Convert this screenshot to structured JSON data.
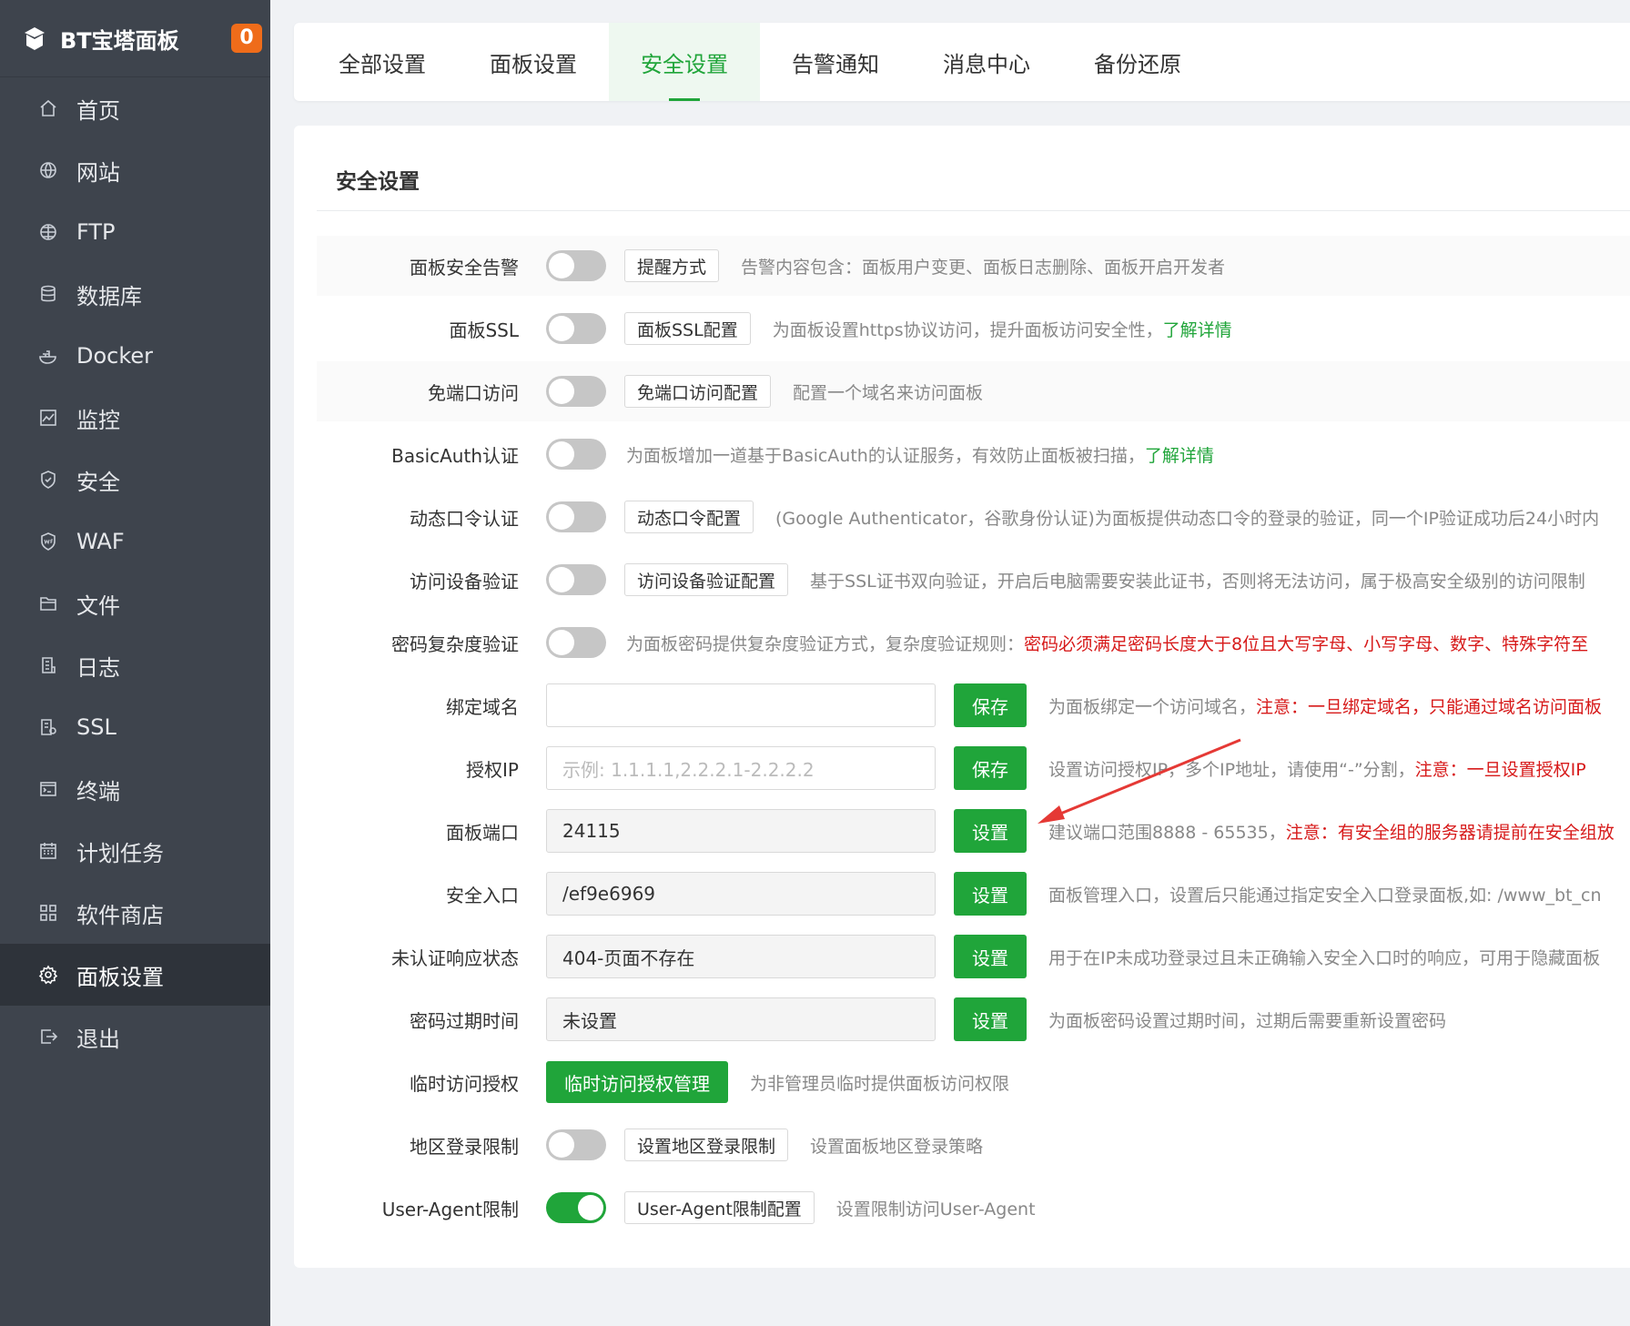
{
  "sidebar": {
    "title": "BT宝塔面板",
    "badge": "0",
    "items": [
      {
        "label": "首页",
        "icon": "home-icon"
      },
      {
        "label": "网站",
        "icon": "globe-icon"
      },
      {
        "label": "FTP",
        "icon": "ftp-icon"
      },
      {
        "label": "数据库",
        "icon": "database-icon"
      },
      {
        "label": "Docker",
        "icon": "docker-icon"
      },
      {
        "label": "监控",
        "icon": "monitor-icon"
      },
      {
        "label": "安全",
        "icon": "shield-icon"
      },
      {
        "label": "WAF",
        "icon": "waf-icon"
      },
      {
        "label": "文件",
        "icon": "folder-icon"
      },
      {
        "label": "日志",
        "icon": "log-icon"
      },
      {
        "label": "SSL",
        "icon": "ssl-icon"
      },
      {
        "label": "终端",
        "icon": "terminal-icon"
      },
      {
        "label": "计划任务",
        "icon": "calendar-icon"
      },
      {
        "label": "软件商店",
        "icon": "apps-icon"
      },
      {
        "label": "面板设置",
        "icon": "gear-icon",
        "active": true
      },
      {
        "label": "退出",
        "icon": "logout-icon"
      }
    ]
  },
  "tabs": [
    {
      "label": "全部设置"
    },
    {
      "label": "面板设置"
    },
    {
      "label": "安全设置",
      "active": true
    },
    {
      "label": "告警通知"
    },
    {
      "label": "消息中心"
    },
    {
      "label": "备份还原"
    }
  ],
  "section_title": "安全设置",
  "rows": {
    "alert": {
      "label": "面板安全告警",
      "toggle_on": false,
      "button": "提醒方式",
      "desc": "告警内容包含：面板用户变更、面板日志删除、面板开启开发者"
    },
    "ssl": {
      "label": "面板SSL",
      "toggle_on": false,
      "button": "面板SSL配置",
      "desc": "为面板设置https协议访问，提升面板访问安全性，",
      "link": "了解详情"
    },
    "noport": {
      "label": "免端口访问",
      "toggle_on": false,
      "button": "免端口访问配置",
      "desc": "配置一个域名来访问面板"
    },
    "basicauth": {
      "label": "BasicAuth认证",
      "toggle_on": false,
      "desc": "为面板增加一道基于BasicAuth的认证服务，有效防止面板被扫描，",
      "link": "了解详情"
    },
    "otp": {
      "label": "动态口令认证",
      "toggle_on": false,
      "button": "动态口令配置",
      "desc": "(Google Authenticator，谷歌身份认证)为面板提供动态口令的登录的验证，同一个IP验证成功后24小时内"
    },
    "device": {
      "label": "访问设备验证",
      "toggle_on": false,
      "button": "访问设备验证配置",
      "desc": "基于SSL证书双向验证，开启后电脑需要安装此证书，否则将无法访问，属于极高安全级别的访问限制"
    },
    "pwdcomplex": {
      "label": "密码复杂度验证",
      "toggle_on": false,
      "desc": "为面板密码提供复杂度验证方式，复杂度验证规则：",
      "warn": "密码必须满足密码长度大于8位且大写字母、小写字母、数字、特殊字符至"
    },
    "domain": {
      "label": "绑定域名",
      "value": "",
      "button": "保存",
      "desc": "为面板绑定一个访问域名，",
      "warn": "注意：一旦绑定域名，只能通过域名访问面板"
    },
    "authip": {
      "label": "授权IP",
      "placeholder": "示例: 1.1.1.1,2.2.2.1-2.2.2.2",
      "button": "保存",
      "desc": "设置访问授权IP，多个IP地址，请使用“-”分割，",
      "warn": "注意：一旦设置授权IP"
    },
    "port": {
      "label": "面板端口",
      "value": "24115",
      "button": "设置",
      "desc": "建议端口范围8888 - 65535，",
      "warn": "注意：有安全组的服务器请提前在安全组放"
    },
    "entry": {
      "label": "安全入口",
      "value": "/ef9e6969",
      "button": "设置",
      "desc": "面板管理入口，设置后只能通过指定安全入口登录面板,如: /www_bt_cn"
    },
    "unauth": {
      "label": "未认证响应状态",
      "value": "404-页面不存在",
      "button": "设置",
      "desc": "用于在IP未成功登录过且未正确输入安全入口时的响应，可用于隐藏面板"
    },
    "pwdexpire": {
      "label": "密码过期时间",
      "value": "未设置",
      "button": "设置",
      "desc": "为面板密码设置过期时间，过期后需要重新设置密码"
    },
    "tempauth": {
      "label": "临时访问授权",
      "button": "临时访问授权管理",
      "desc": "为非管理员临时提供面板访问权限"
    },
    "region": {
      "label": "地区登录限制",
      "toggle_on": false,
      "button": "设置地区登录限制",
      "desc": "设置面板地区登录策略"
    },
    "useragent": {
      "label": "User-Agent限制",
      "toggle_on": true,
      "button": "User-Agent限制配置",
      "desc": "设置限制访问User-Agent"
    }
  },
  "colors": {
    "accent": "#20a53a",
    "warn": "#d71a1a",
    "sidebar": "#3e444d",
    "badge": "#ef6c1a",
    "annotation_arrow": "#e53935"
  }
}
